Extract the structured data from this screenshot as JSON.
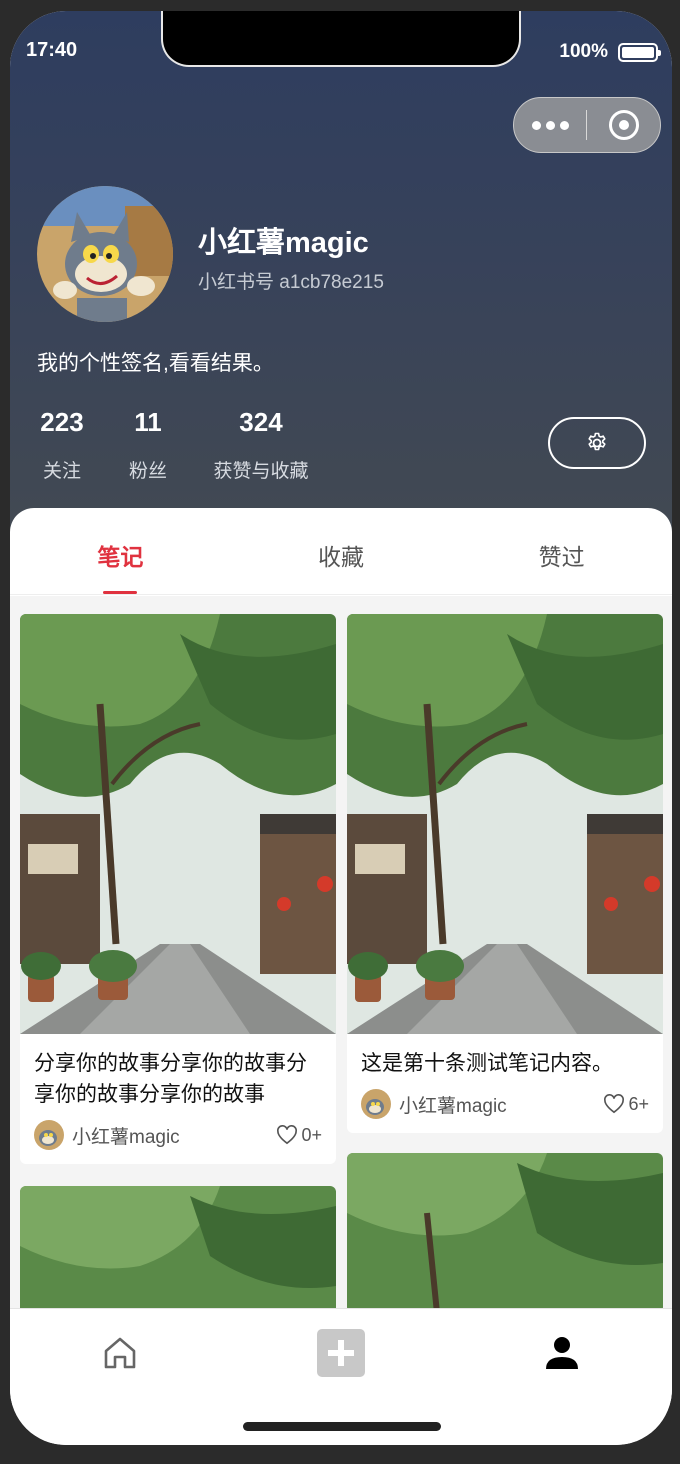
{
  "status_bar": {
    "time": "17:40",
    "battery": "100%"
  },
  "profile": {
    "username": "小红薯magic",
    "user_id": "小红书号 a1cb78e215",
    "bio": "我的个性签名,看看结果。",
    "stats": [
      {
        "value": "223",
        "label": "关注"
      },
      {
        "value": "11",
        "label": "粉丝"
      },
      {
        "value": "324",
        "label": "获赞与收藏"
      }
    ]
  },
  "tabs": [
    {
      "label": "笔记",
      "active": true
    },
    {
      "label": "收藏",
      "active": false
    },
    {
      "label": "赞过",
      "active": false
    }
  ],
  "notes": [
    {
      "title": "分享你的故事分享你的故事分享你的故事分享你的故事",
      "author": "小红薯magic",
      "likes": "0+"
    },
    {
      "title": "这是第十条测试笔记内容。",
      "author": "小红薯magic",
      "likes": "6+"
    }
  ],
  "icons": {
    "settings": "gear-icon",
    "home": "home-icon",
    "add": "add-icon",
    "profile": "user-icon",
    "like": "heart-icon"
  },
  "colors": {
    "accent": "#e0323f",
    "header_top": "#2e3d5f",
    "header_bottom": "#434a52"
  }
}
